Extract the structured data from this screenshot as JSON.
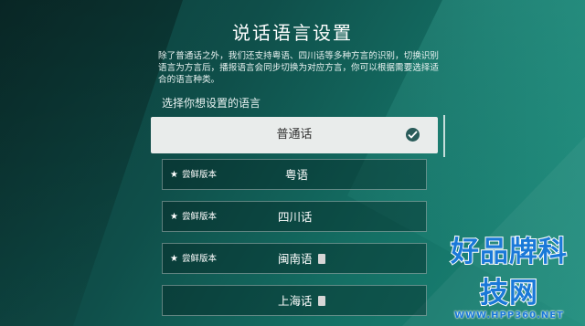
{
  "title": "说话语言设置",
  "description": "除了普通话之外，我们还支持粤语、四川话等多种方言的识别，切换识别语言为方言后，播报语言会同步切换为对应方言，你可以根据需要选择适合的语言种类。",
  "prompt": "选择你想设置的语言",
  "languages": [
    {
      "name": "普通话",
      "badge": "",
      "selected": true
    },
    {
      "name": "粤语",
      "badge": "尝鲜版本",
      "selected": false
    },
    {
      "name": "四川话",
      "badge": "尝鲜版本",
      "selected": false
    },
    {
      "name": "闽南语",
      "badge": "尝鲜版本",
      "selected": false
    },
    {
      "name": "上海话",
      "badge": "",
      "selected": false
    }
  ],
  "watermark": {
    "text": "好品牌科技网",
    "url": "WWW.HPP360.NET"
  },
  "colors": {
    "accent": "#2a5c5a",
    "watermark": "#1a79d8"
  }
}
